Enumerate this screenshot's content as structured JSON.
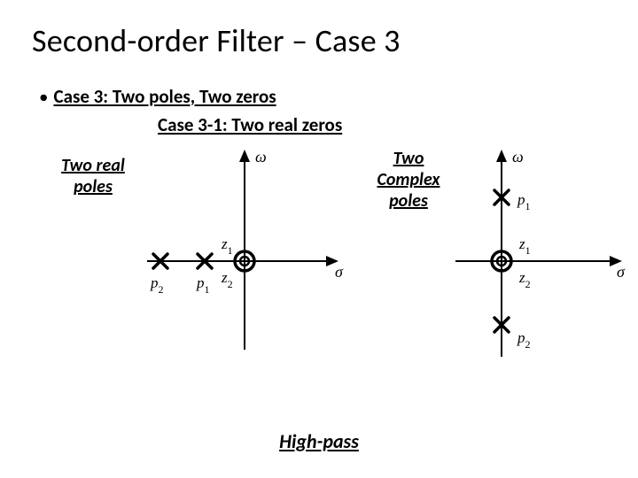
{
  "title": "Second-order Filter – Case 3",
  "bullet1": "Case 3: Two poles, Two zeros",
  "bullet2": "Case 3-1: Two real zeros",
  "left_caption_line1": "Two real",
  "left_caption_line2": "poles",
  "right_caption_line1": "Two",
  "right_caption_line2": "Complex",
  "right_caption_line3": "poles",
  "footer": "High-pass",
  "axis_omega": "ω",
  "axis_sigma": "σ",
  "label_z1": "z",
  "label_z1_sub": "1",
  "label_z2": "z",
  "label_z2_sub": "2",
  "label_p1": "p",
  "label_p1_sub": "1",
  "label_p2": "p",
  "label_p2_sub": "2",
  "chart_data": [
    {
      "type": "pole-zero",
      "description": "Left plane: two real poles on negative sigma axis, double zero at origin",
      "poles": [
        {
          "name": "p1",
          "x": -45,
          "y": 0
        },
        {
          "name": "p2",
          "x": -95,
          "y": 0
        }
      ],
      "zeros": [
        {
          "name": "z1,z2",
          "x": 0,
          "y": 0,
          "multiplicity": 2
        }
      ]
    },
    {
      "type": "pole-zero",
      "description": "Right plane: complex-conjugate pole pair on positive imaginary axis region, double zero at origin",
      "poles": [
        {
          "name": "p1",
          "x": 0,
          "y": 72
        },
        {
          "name": "p2",
          "x": 0,
          "y": -72
        }
      ],
      "zeros": [
        {
          "name": "z1,z2",
          "x": 0,
          "y": 0,
          "multiplicity": 2
        }
      ]
    }
  ]
}
